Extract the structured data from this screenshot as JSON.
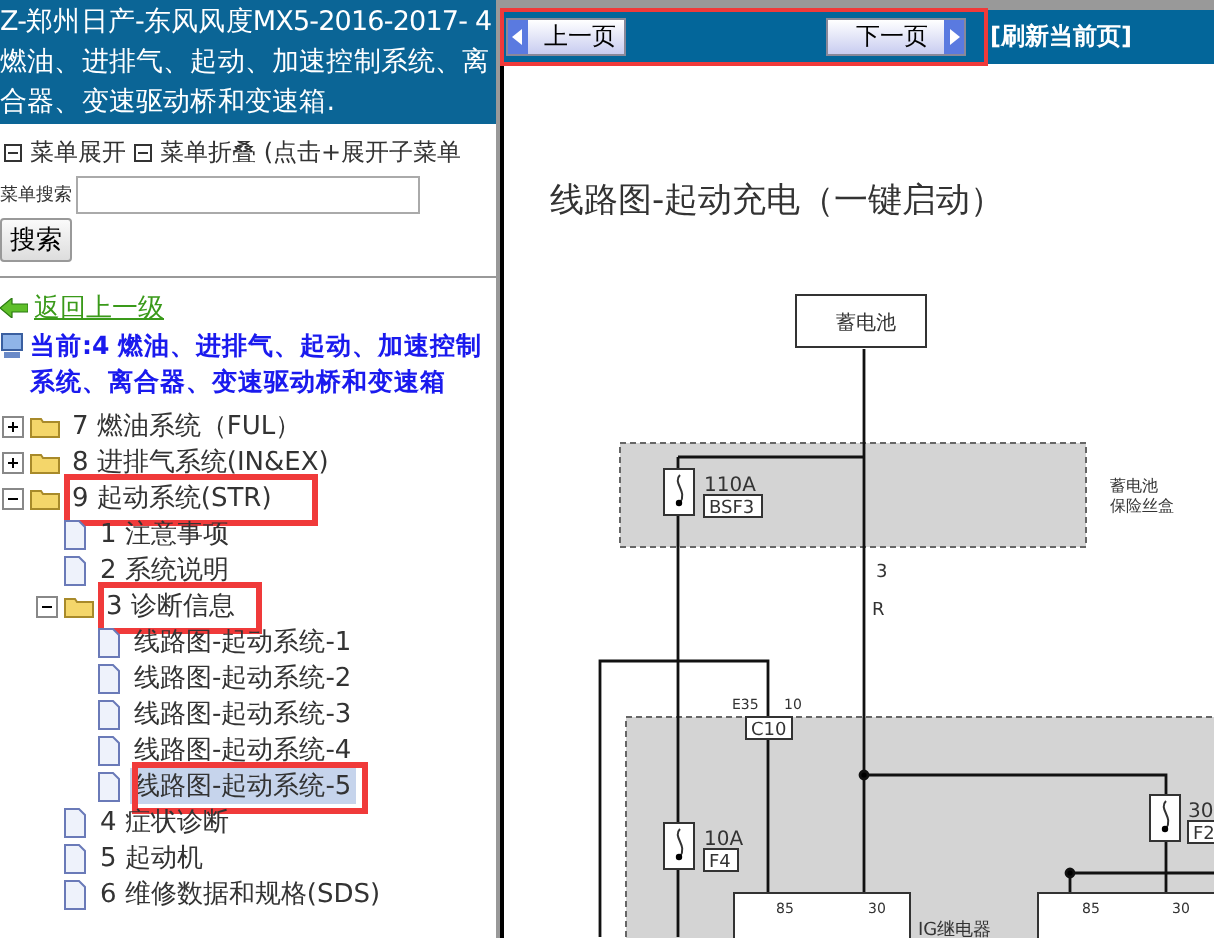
{
  "sidebar": {
    "title": "Z-郑州日产-东风风度MX5-2016-2017- 4 燃油、进排气、起动、加速控制系统、离合器、变速驱动桥和变速箱.",
    "menu_toggles": [
      "菜单展开",
      "菜单折叠 (点击+展开子菜单"
    ],
    "search": {
      "label": "菜单搜索",
      "button": "搜索"
    },
    "back_link": "返回上一级",
    "current": "当前:4 燃油、进排气、起动、加速控制系统、离合器、变速驱动桥和变速箱",
    "tree": [
      {
        "kind": "folder",
        "label": "7 燃油系统（FUL）",
        "expanded": false,
        "selected": false,
        "highlighted": false
      },
      {
        "kind": "folder",
        "label": "8 进排气系统(IN&EX)",
        "expanded": false,
        "selected": false,
        "highlighted": false
      },
      {
        "kind": "folder",
        "label": "9 起动系统(STR)",
        "expanded": true,
        "selected": false,
        "highlighted": true,
        "children": [
          {
            "kind": "page",
            "label": "1 注意事项",
            "selected": false,
            "highlighted": false
          },
          {
            "kind": "page",
            "label": "2 系统说明",
            "selected": false,
            "highlighted": false
          },
          {
            "kind": "folder",
            "label": "3 诊断信息",
            "expanded": true,
            "selected": false,
            "highlighted": true,
            "children": [
              {
                "kind": "page",
                "label": "线路图-起动系统-1",
                "selected": false,
                "highlighted": false
              },
              {
                "kind": "page",
                "label": "线路图-起动系统-2",
                "selected": false,
                "highlighted": false
              },
              {
                "kind": "page",
                "label": "线路图-起动系统-3",
                "selected": false,
                "highlighted": false
              },
              {
                "kind": "page",
                "label": "线路图-起动系统-4",
                "selected": false,
                "highlighted": false
              },
              {
                "kind": "page",
                "label": "线路图-起动系统-5",
                "selected": true,
                "highlighted": true
              }
            ]
          },
          {
            "kind": "page",
            "label": "4 症状诊断",
            "selected": false,
            "highlighted": false
          },
          {
            "kind": "page",
            "label": "5 起动机",
            "selected": false,
            "highlighted": false
          },
          {
            "kind": "page",
            "label": "6 维修数据和规格(SDS)",
            "selected": false,
            "highlighted": false
          }
        ]
      }
    ]
  },
  "navbar": {
    "prev": "上一页",
    "next": "下一页",
    "refresh": "[刷新当前页]",
    "highlighted": true
  },
  "diagram": {
    "title": "线路图-起动充电（一键启动）",
    "battery": "蓄电池",
    "fuse_box": "蓄电池保险丝盒",
    "main_fuse": {
      "rating": "110A",
      "code": "BSF3"
    },
    "wire": {
      "number": "3",
      "code": "R"
    },
    "connector": {
      "name": "E35",
      "pin": "10",
      "code": "C10"
    },
    "fuse_left": {
      "rating": "10A",
      "code": "F4"
    },
    "fuse_right": {
      "rating": "30",
      "code": "F2"
    },
    "relay_pins": [
      "85",
      "30",
      "85",
      "30"
    ],
    "relay_label": "IG继电器"
  }
}
